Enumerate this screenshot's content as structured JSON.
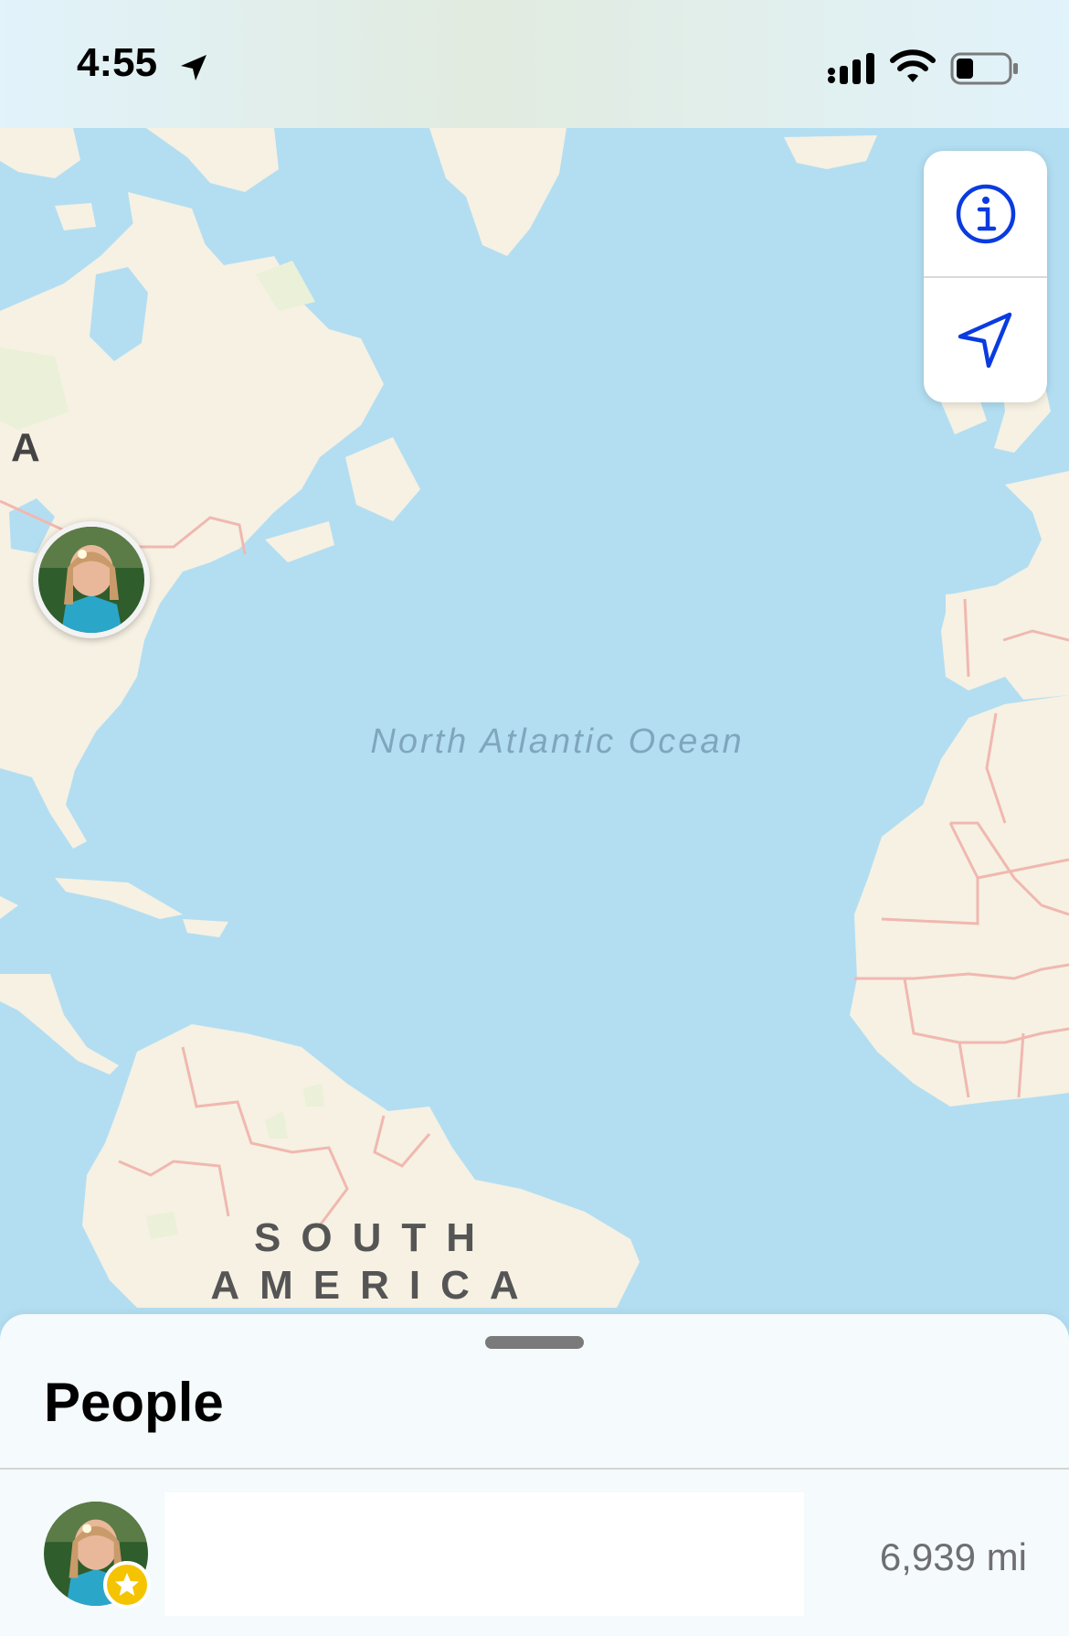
{
  "status_bar": {
    "time": "4:55",
    "location_icon": "location-arrow-icon",
    "signal_icon": "cellular-signal-icon",
    "wifi_icon": "wifi-icon",
    "battery_icon": "battery-icon"
  },
  "map": {
    "labels": {
      "region_letter": "A",
      "ocean": "North Atlantic Ocean",
      "continent": "SOUTH AMERICA"
    },
    "controls": {
      "info_icon": "info-icon",
      "tracking_icon": "location-arrow-icon"
    },
    "colors": {
      "water": "#b3def2",
      "land": "#f6f1e3",
      "land_green": "#ebf0d8",
      "border": "#f0b8b0",
      "accent": "#0a3be0"
    }
  },
  "sheet": {
    "title": "People",
    "people": [
      {
        "name": "",
        "distance": "6,939 mi",
        "favorite": true
      }
    ]
  }
}
